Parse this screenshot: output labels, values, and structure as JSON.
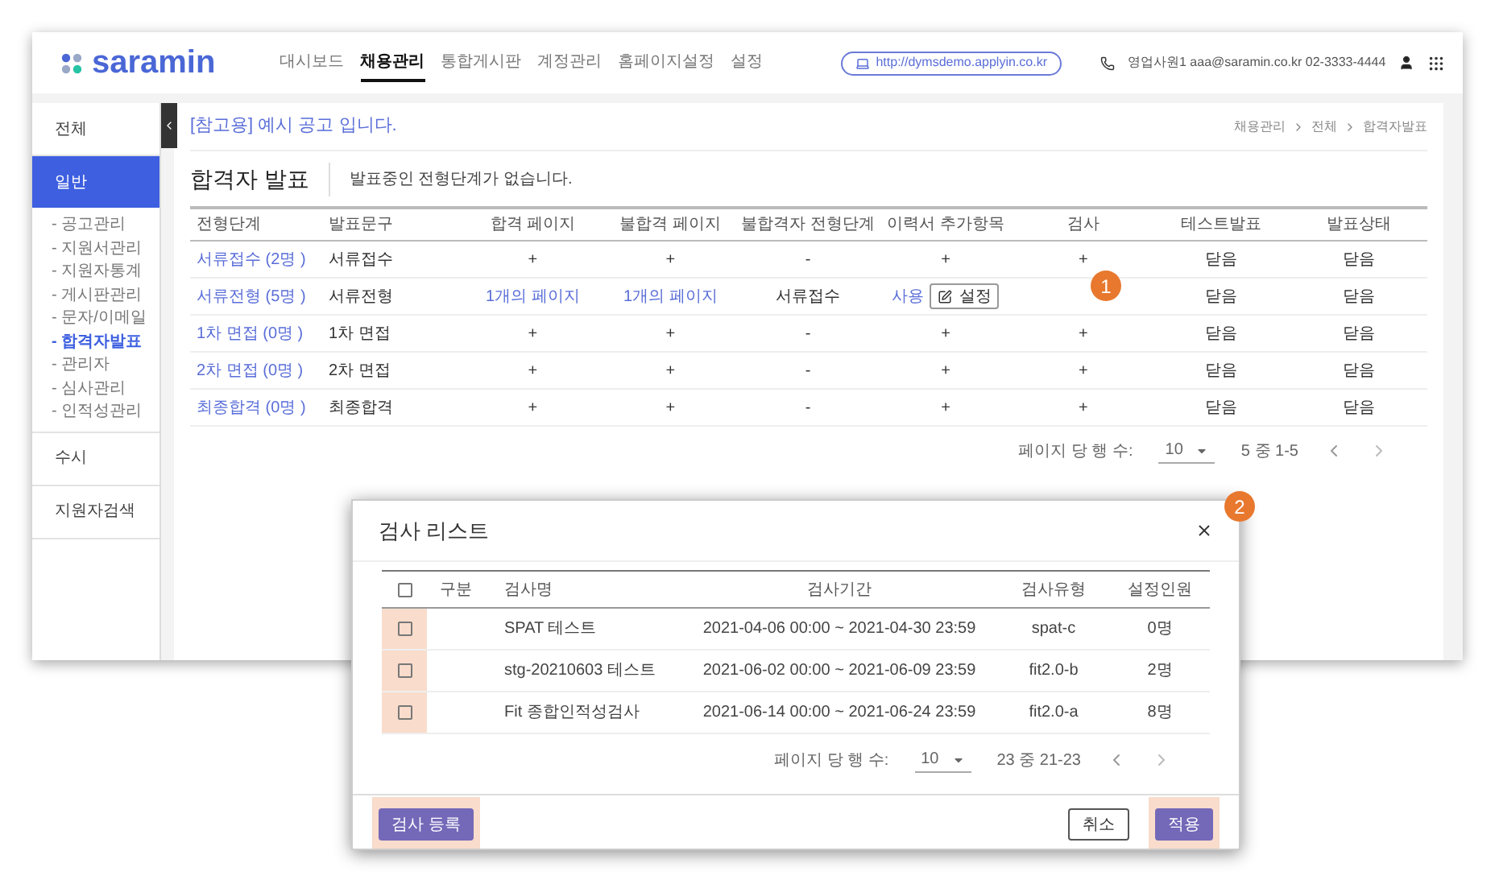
{
  "header": {
    "logo": "saramin",
    "nav": [
      {
        "label": "대시보드",
        "selected": false
      },
      {
        "label": "채용관리",
        "selected": true
      },
      {
        "label": "통합게시판",
        "selected": false
      },
      {
        "label": "계정관리",
        "selected": false
      },
      {
        "label": "홈페이지설정",
        "selected": false
      },
      {
        "label": "설정",
        "selected": false
      }
    ],
    "site_url": "http://dymsdemo.applyin.co.kr",
    "contact": "영업사원1 aaa@saramin.co.kr 02-3333-4444"
  },
  "sidebar": {
    "items": [
      {
        "label": "전체",
        "selected": false
      },
      {
        "label": "일반",
        "selected": true,
        "children": [
          {
            "label": "- 공고관리",
            "selected": false
          },
          {
            "label": "- 지원서관리",
            "selected": false
          },
          {
            "label": "- 지원자통계",
            "selected": false
          },
          {
            "label": "- 게시판관리",
            "selected": false
          },
          {
            "label": "- 문자/이메일",
            "selected": false
          },
          {
            "label": "- 합격자발표",
            "selected": true
          },
          {
            "label": "- 관리자",
            "selected": false
          },
          {
            "label": "- 심사관리",
            "selected": false
          },
          {
            "label": "- 인적성관리",
            "selected": false
          }
        ]
      },
      {
        "label": "수시",
        "selected": false
      },
      {
        "label": "지원자검색",
        "selected": false
      }
    ]
  },
  "notice_title": "[참고용] 예시 공고 입니다.",
  "breadcrumb": [
    "채용관리",
    "전체",
    "합격자발표"
  ],
  "section": {
    "title": "합격자 발표",
    "message": "발표중인 전형단계가 없습니다."
  },
  "table": {
    "columns": [
      "전형단계",
      "발표문구",
      "합격 페이지",
      "불합격 페이지",
      "불합격자 전형단계",
      "이력서 추가항목",
      "검사",
      "테스트발표",
      "발표상태"
    ],
    "rows": [
      {
        "cells": [
          {
            "kind": "link",
            "text": "서류접수 (2명 )"
          },
          {
            "kind": "text",
            "text": "서류접수"
          },
          {
            "kind": "text",
            "text": "+"
          },
          {
            "kind": "text",
            "text": "+"
          },
          {
            "kind": "text",
            "text": "-"
          },
          {
            "kind": "text",
            "text": "+"
          },
          {
            "kind": "text",
            "text": "+"
          },
          {
            "kind": "text",
            "text": "닫음"
          },
          {
            "kind": "text",
            "text": "닫음"
          }
        ]
      },
      {
        "cells": [
          {
            "kind": "link",
            "text": "서류전형 (5명 )"
          },
          {
            "kind": "text",
            "text": "서류전형"
          },
          {
            "kind": "link",
            "text": "1개의 페이지"
          },
          {
            "kind": "link",
            "text": "1개의 페이지"
          },
          {
            "kind": "text",
            "text": "서류접수"
          },
          {
            "kind": "setting",
            "text": "사용",
            "button": "설정"
          },
          {
            "kind": "empty"
          },
          {
            "kind": "text",
            "text": "닫음"
          },
          {
            "kind": "text",
            "text": "닫음"
          }
        ]
      },
      {
        "cells": [
          {
            "kind": "link",
            "text": "1차 면접 (0명 )"
          },
          {
            "kind": "text",
            "text": "1차 면접"
          },
          {
            "kind": "text",
            "text": "+"
          },
          {
            "kind": "text",
            "text": "+"
          },
          {
            "kind": "text",
            "text": "-"
          },
          {
            "kind": "text",
            "text": "+"
          },
          {
            "kind": "text",
            "text": "+"
          },
          {
            "kind": "text",
            "text": "닫음"
          },
          {
            "kind": "text",
            "text": "닫음"
          }
        ]
      },
      {
        "cells": [
          {
            "kind": "link",
            "text": "2차 면접 (0명 )"
          },
          {
            "kind": "text",
            "text": "2차 면접"
          },
          {
            "kind": "text",
            "text": "+"
          },
          {
            "kind": "text",
            "text": "+"
          },
          {
            "kind": "text",
            "text": "-"
          },
          {
            "kind": "text",
            "text": "+"
          },
          {
            "kind": "text",
            "text": "+"
          },
          {
            "kind": "text",
            "text": "닫음"
          },
          {
            "kind": "text",
            "text": "닫음"
          }
        ]
      },
      {
        "cells": [
          {
            "kind": "link",
            "text": "최종합격 (0명 )"
          },
          {
            "kind": "text",
            "text": "최종합격"
          },
          {
            "kind": "text",
            "text": "+"
          },
          {
            "kind": "text",
            "text": "+"
          },
          {
            "kind": "text",
            "text": "-"
          },
          {
            "kind": "text",
            "text": "+"
          },
          {
            "kind": "text",
            "text": "+"
          },
          {
            "kind": "text",
            "text": "닫음"
          },
          {
            "kind": "text",
            "text": "닫음"
          }
        ]
      }
    ]
  },
  "pagination": {
    "rows_label": "페이지 당 행 수:",
    "rows_value": "10",
    "range": "5 중 1-5"
  },
  "dialog": {
    "title": "검사 리스트",
    "header_checked": false,
    "columns": [
      "구분",
      "검사명",
      "검사기간",
      "검사유형",
      "설정인원"
    ],
    "rows": [
      {
        "checked": false,
        "highlighted": true,
        "category": "",
        "name": "SPAT 테스트",
        "period": "2021-04-06 00:00 ~ 2021-04-30 23:59",
        "type": "spat-c",
        "count": "0명"
      },
      {
        "checked": false,
        "highlighted": true,
        "category": "",
        "name": "stg-20210603 테스트",
        "period": "2021-06-02 00:00 ~ 2021-06-09 23:59",
        "type": "fit2.0-b",
        "count": "2명"
      },
      {
        "checked": false,
        "highlighted": true,
        "category": "",
        "name": "Fit 종합인적성검사",
        "period": "2021-06-14 00:00 ~ 2021-06-24 23:59",
        "type": "fit2.0-a",
        "count": "8명"
      }
    ],
    "pagination": {
      "rows_label": "페이지 당 행 수:",
      "rows_value": "10",
      "range": "23 중 21-23"
    },
    "buttons": [
      {
        "kind": "primary",
        "label": "검사 등록",
        "highlighted": true
      },
      {
        "kind": "outline",
        "label": "취소",
        "highlighted": false
      },
      {
        "kind": "primary",
        "label": "적용",
        "highlighted": true
      }
    ]
  },
  "callouts": [
    {
      "label": "1"
    },
    {
      "label": "2"
    }
  ]
}
